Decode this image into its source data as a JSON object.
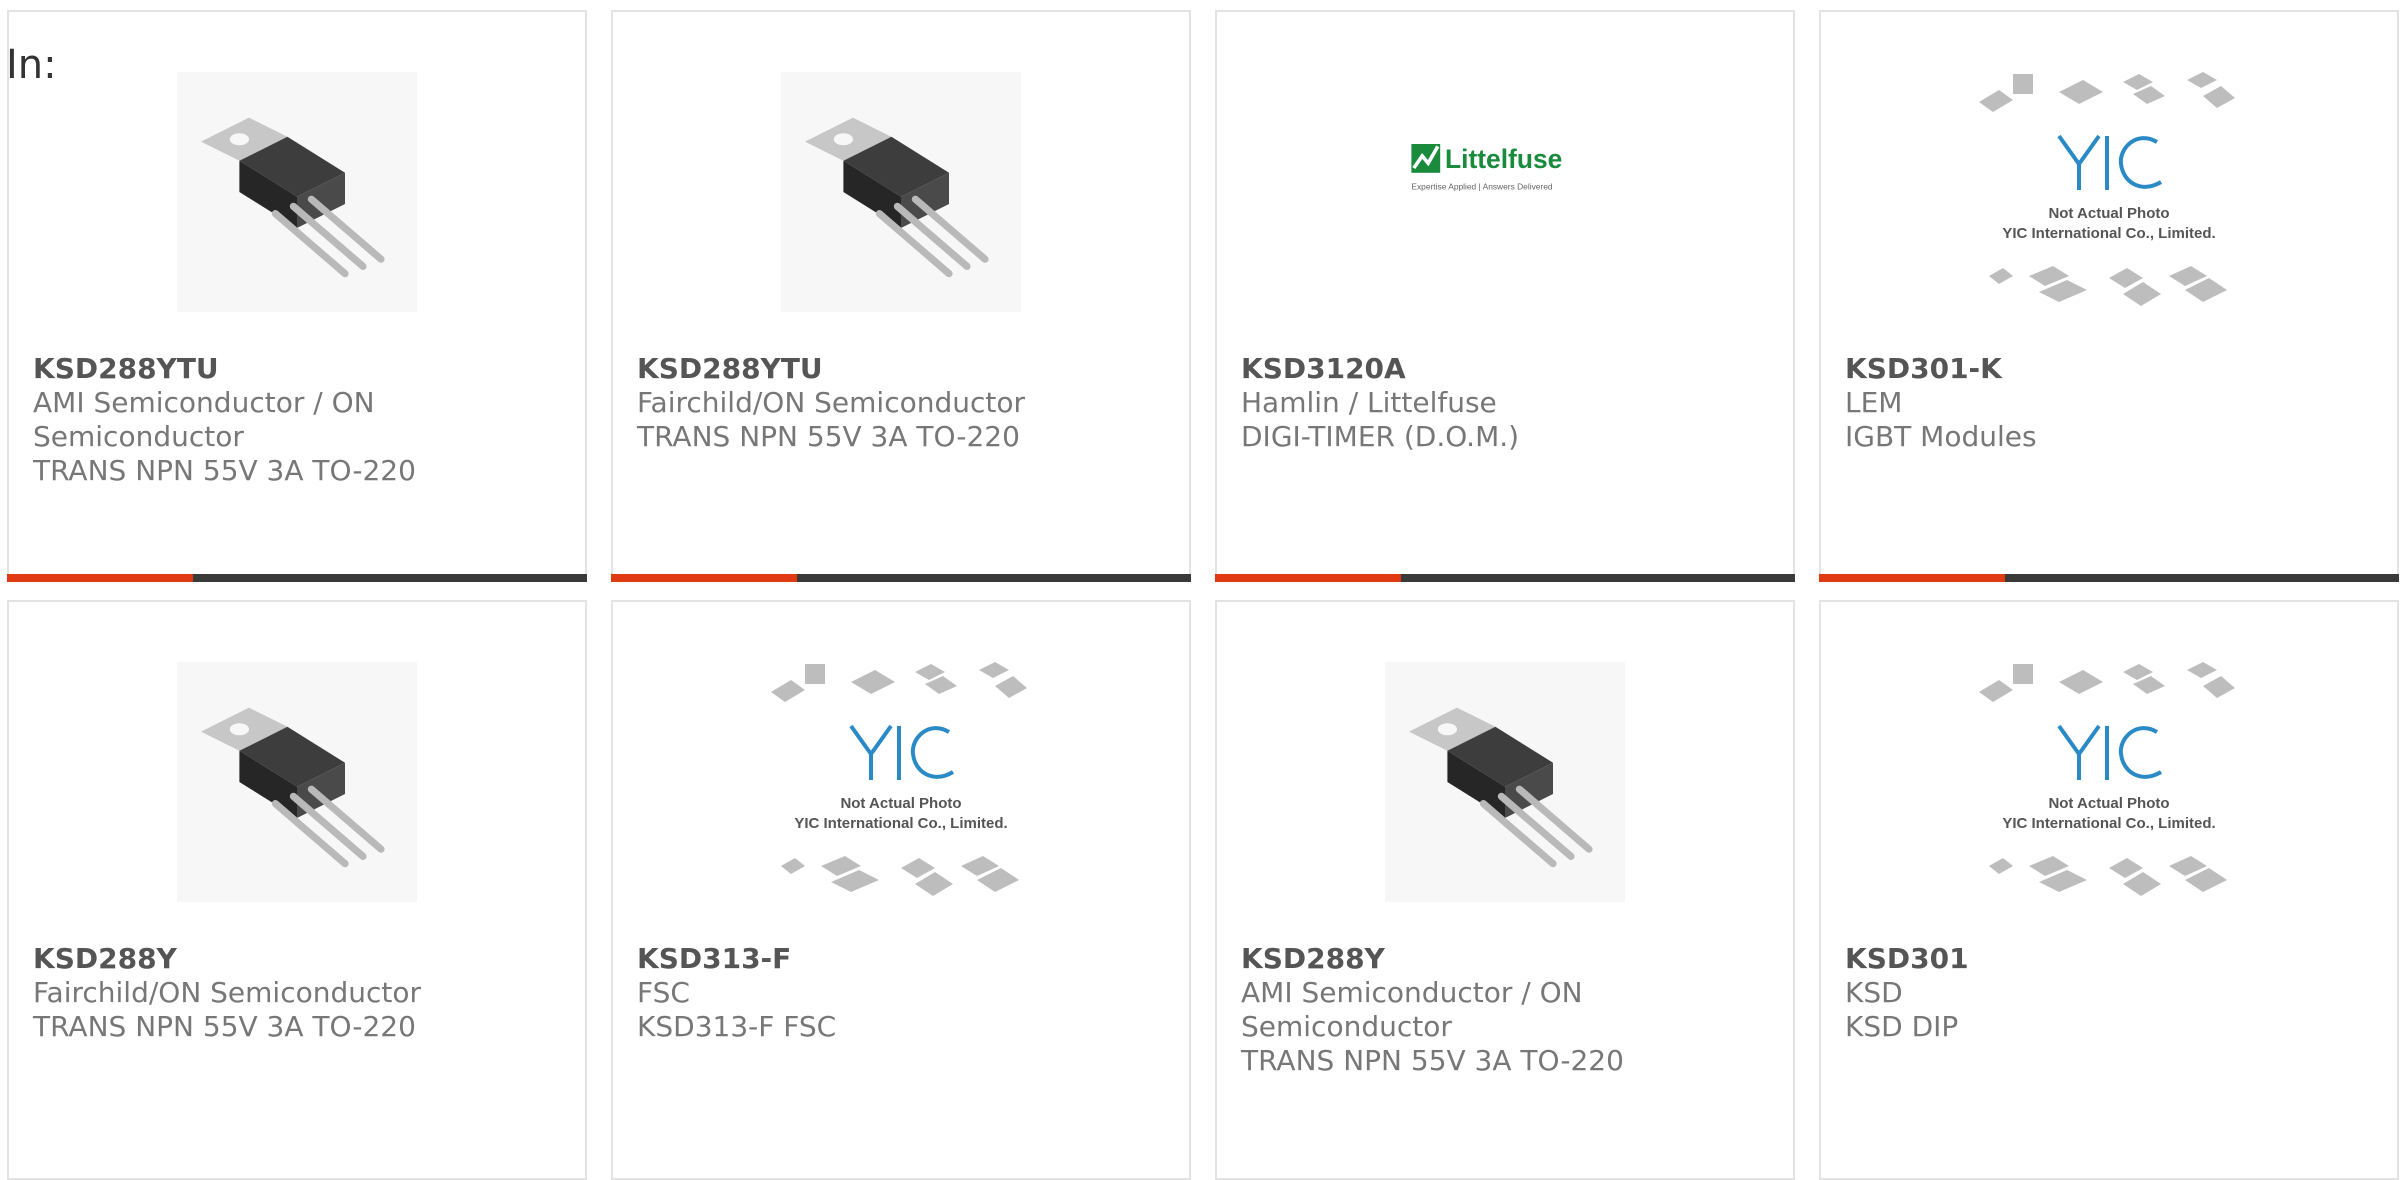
{
  "header": {
    "in_label": "In:"
  },
  "products": [
    {
      "part": "KSD288YTU",
      "manufacturer": "AMI Semiconductor / ON Semiconductor",
      "description": "TRANS NPN 55V 3A TO-220",
      "image": "to220-transistor"
    },
    {
      "part": "KSD288YTU",
      "manufacturer": "Fairchild/ON Semiconductor",
      "description": "TRANS NPN 55V 3A TO-220",
      "image": "to220-transistor"
    },
    {
      "part": "KSD3120A",
      "manufacturer": "Hamlin / Littelfuse",
      "description": "DIGI-TIMER (D.O.M.)",
      "image": "littelfuse-logo"
    },
    {
      "part": "KSD301-K",
      "manufacturer": "LEM",
      "description": "IGBT Modules",
      "image": "yic-placeholder"
    },
    {
      "part": "KSD288Y",
      "manufacturer": "Fairchild/ON Semiconductor",
      "description": "TRANS NPN 55V 3A TO-220",
      "image": "to220-transistor"
    },
    {
      "part": "KSD313-F",
      "manufacturer": "FSC",
      "description": "KSD313-F FSC",
      "image": "yic-placeholder"
    },
    {
      "part": "KSD288Y",
      "manufacturer": "AMI Semiconductor / ON Semiconductor",
      "description": "TRANS NPN 55V 3A TO-220",
      "image": "yic-placeholder-transistor"
    },
    {
      "part": "KSD301",
      "manufacturer": "KSD",
      "description": "KSD DIP",
      "image": "yic-placeholder"
    }
  ],
  "logo_text": {
    "littelfuse_name": "Littelfuse",
    "littelfuse_tagline": "Expertise Applied | Answers Delivered"
  },
  "placeholder_text": {
    "line1": "Not Actual Photo",
    "line2": "YIC International Co., Limited."
  },
  "colors": {
    "accent": "#e03a12",
    "bar": "#3a3a3a",
    "border": "#e3e3e3",
    "littelfuse_green": "#1a8a3c",
    "yic_blue": "#2a8ac6"
  }
}
